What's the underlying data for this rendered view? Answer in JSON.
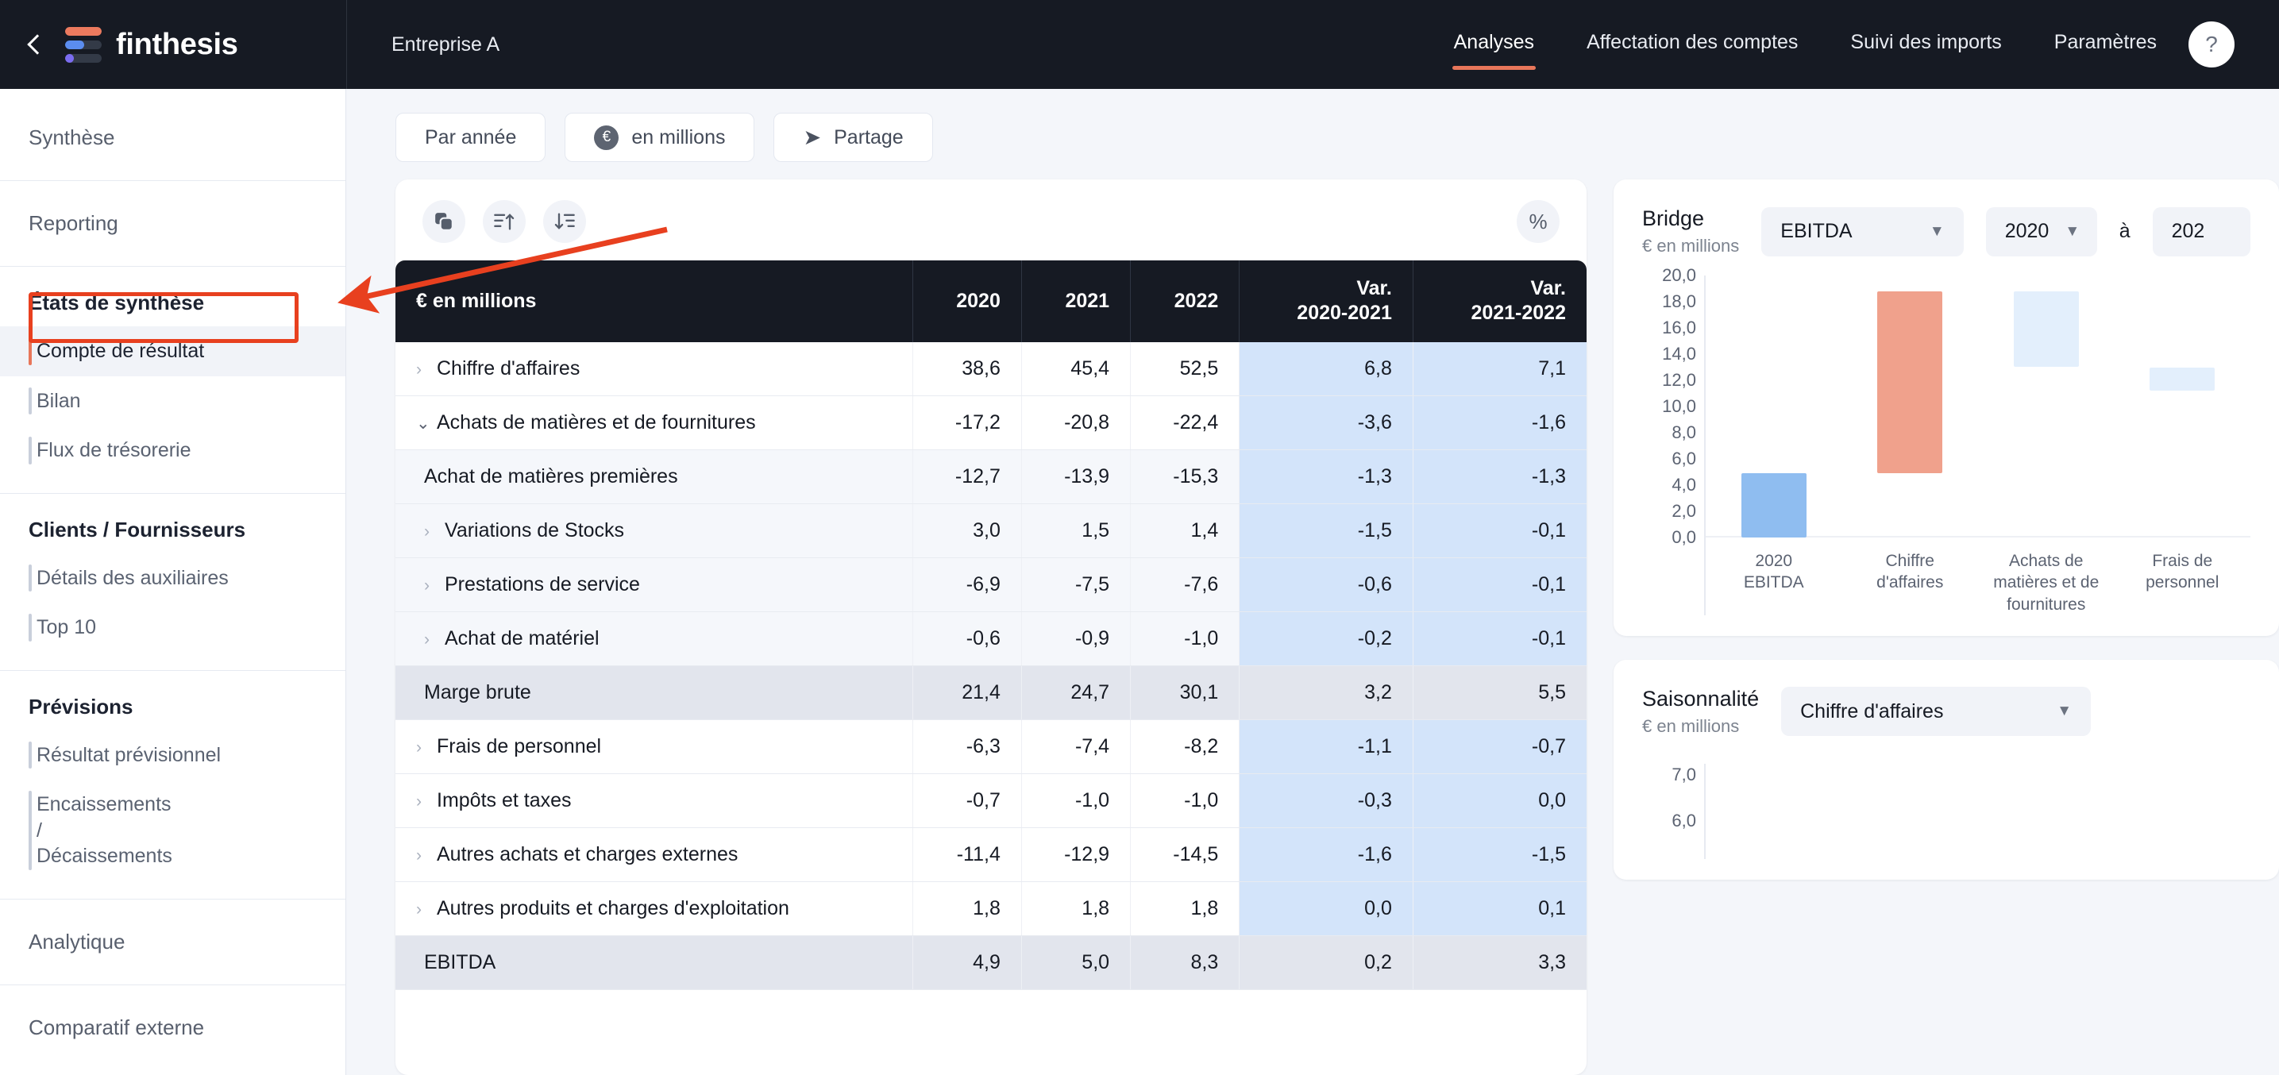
{
  "brand": {
    "name": "finthesis",
    "back_icon": "chevron-left-icon",
    "logo_icon": "finthesis-logo-icon"
  },
  "header": {
    "company": "Entreprise A",
    "nav": [
      {
        "label": "Analyses",
        "active": true
      },
      {
        "label": "Affectation des comptes",
        "active": false
      },
      {
        "label": "Suivi des imports",
        "active": false
      },
      {
        "label": "Paramètres",
        "active": false
      }
    ],
    "help_label": "?",
    "accent_color": "#e8765a"
  },
  "sidebar": {
    "groups": [
      {
        "top": "Synthèse"
      },
      {
        "top": "Reporting"
      },
      {
        "head": "États de synthèse",
        "items": [
          {
            "label": "Compte de résultat",
            "active": true
          },
          {
            "label": "Bilan",
            "active": false
          },
          {
            "label": "Flux de trésorerie",
            "active": false
          }
        ]
      },
      {
        "head": "Clients / Fournisseurs",
        "items": [
          {
            "label": "Détails des auxiliaires",
            "active": false
          },
          {
            "label": "Top 10",
            "active": false
          }
        ]
      },
      {
        "head": "Prévisions",
        "items": [
          {
            "label": "Résultat prévisionnel",
            "active": false
          },
          {
            "label": "Encaissements / Décaissements",
            "active": false
          }
        ]
      },
      {
        "top": "Analytique"
      },
      {
        "top": "Comparatif externe"
      }
    ]
  },
  "toolbar": {
    "period_label": "Par année",
    "unit_label": "en millions",
    "unit_icon": "euro-circle-icon",
    "share_label": "Partage",
    "share_icon": "share-arrow-icon"
  },
  "table_tools": {
    "duplicate_icon": "copy-icon",
    "sort_asc_icon": "sort-ascending-icon",
    "sort_desc_icon": "sort-descending-icon",
    "percent_label": "%"
  },
  "table": {
    "columns": [
      "€ en millions",
      "2020",
      "2021",
      "2022",
      "Var. 2020-2021",
      "Var. 2021-2022"
    ],
    "column_lines": [
      [
        "€ en millions"
      ],
      [
        "2020"
      ],
      [
        "2021"
      ],
      [
        "2022"
      ],
      [
        "Var.",
        "2020-2021"
      ],
      [
        "Var.",
        "2021-2022"
      ]
    ],
    "rows": [
      {
        "label": "Chiffre d'affaires",
        "level": 0,
        "chev": "right",
        "values": [
          "38,6",
          "45,4",
          "52,5",
          "6,8",
          "7,1"
        ],
        "style": "plain"
      },
      {
        "label": "Achats de matières et de fournitures",
        "level": 0,
        "chev": "down",
        "values": [
          "-17,2",
          "-20,8",
          "-22,4",
          "-3,6",
          "-1,6"
        ],
        "style": "plain"
      },
      {
        "label": "Achat de matières premières",
        "level": 1,
        "chev": "none",
        "values": [
          "-12,7",
          "-13,9",
          "-15,3",
          "-1,3",
          "-1,3"
        ],
        "style": "shade"
      },
      {
        "label": "Variations de Stocks",
        "level": 1,
        "chev": "right",
        "values": [
          "3,0",
          "1,5",
          "1,4",
          "-1,5",
          "-0,1"
        ],
        "style": "shade"
      },
      {
        "label": "Prestations de service",
        "level": 1,
        "chev": "right",
        "values": [
          "-6,9",
          "-7,5",
          "-7,6",
          "-0,6",
          "-0,1"
        ],
        "style": "shade"
      },
      {
        "label": "Achat de matériel",
        "level": 1,
        "chev": "right",
        "values": [
          "-0,6",
          "-0,9",
          "-1,0",
          "-0,2",
          "-0,1"
        ],
        "style": "shade"
      },
      {
        "label": "Marge brute",
        "level": 1,
        "chev": "none",
        "values": [
          "21,4",
          "24,7",
          "30,1",
          "3,2",
          "5,5"
        ],
        "style": "total"
      },
      {
        "label": "Frais de personnel",
        "level": 0,
        "chev": "right",
        "values": [
          "-6,3",
          "-7,4",
          "-8,2",
          "-1,1",
          "-0,7"
        ],
        "style": "plain"
      },
      {
        "label": "Impôts et taxes",
        "level": 0,
        "chev": "right",
        "values": [
          "-0,7",
          "-1,0",
          "-1,0",
          "-0,3",
          "0,0"
        ],
        "style": "plain"
      },
      {
        "label": "Autres achats et charges externes",
        "level": 0,
        "chev": "right",
        "values": [
          "-11,4",
          "-12,9",
          "-14,5",
          "-1,6",
          "-1,5"
        ],
        "style": "plain"
      },
      {
        "label": "Autres produits et charges d'exploitation",
        "level": 0,
        "chev": "right",
        "values": [
          "1,8",
          "1,8",
          "1,8",
          "0,0",
          "0,1"
        ],
        "style": "plain"
      },
      {
        "label": "EBITDA",
        "level": 1,
        "chev": "none",
        "values": [
          "4,9",
          "5,0",
          "8,3",
          "0,2",
          "3,3"
        ],
        "style": "total"
      }
    ]
  },
  "bridge": {
    "title": "Bridge",
    "subtitle": "€ en millions",
    "metric": "EBITDA",
    "year_from": "2020",
    "conjunction": "à",
    "year_to": "202"
  },
  "season": {
    "title": "Saisonnalité",
    "subtitle": "€ en millions",
    "metric": "Chiffre d'affaires"
  },
  "chart_data": [
    {
      "type": "bar",
      "title": "Bridge",
      "subtitle": "€ en millions",
      "variant": "waterfall",
      "categories": [
        "2020 EBITDA",
        "Chiffre d'affaires",
        "Achats de matières et de fournitures",
        "Frais de personnel"
      ],
      "category_lines": [
        [
          "2020",
          "EBITDA"
        ],
        [
          "Chiffre",
          "d'affaires"
        ],
        [
          "Achats de",
          "matières et de",
          "fournitures"
        ],
        [
          "Frais de",
          "personnel"
        ]
      ],
      "bars": [
        {
          "label": "2020 EBITDA",
          "base": 0.0,
          "top": 4.9,
          "value": 4.9,
          "color": "#8fbdf0",
          "kind": "total"
        },
        {
          "label": "Chiffre d'affaires",
          "base": 4.9,
          "top": 18.8,
          "value": 13.9,
          "color": "#f0a18c",
          "kind": "increase"
        },
        {
          "label": "Achats de matières et de fournitures",
          "base": 13.0,
          "top": 18.8,
          "value": -5.8,
          "color": "#e3effc",
          "kind": "decrease"
        },
        {
          "label": "Frais de personnel",
          "base": 11.2,
          "top": 13.0,
          "value": -1.8,
          "color": "#e3effc",
          "kind": "decrease"
        }
      ],
      "ylim": [
        0,
        20
      ],
      "ytick_step": 2,
      "yticks": [
        "20,0",
        "18,0",
        "16,0",
        "14,0",
        "12,0",
        "10,0",
        "8,0",
        "6,0",
        "4,0",
        "2,0",
        "0,0"
      ],
      "ylabel": "",
      "xlabel": "",
      "grid": false,
      "legend": "none"
    },
    {
      "type": "bar",
      "title": "Saisonnalité",
      "subtitle": "€ en millions",
      "metric": "Chiffre d'affaires",
      "yticks": [
        "7,0",
        "6,0"
      ],
      "ylim": [
        0,
        7
      ],
      "note": "chart clipped by viewport bottom",
      "grid": false,
      "legend": "none"
    }
  ]
}
